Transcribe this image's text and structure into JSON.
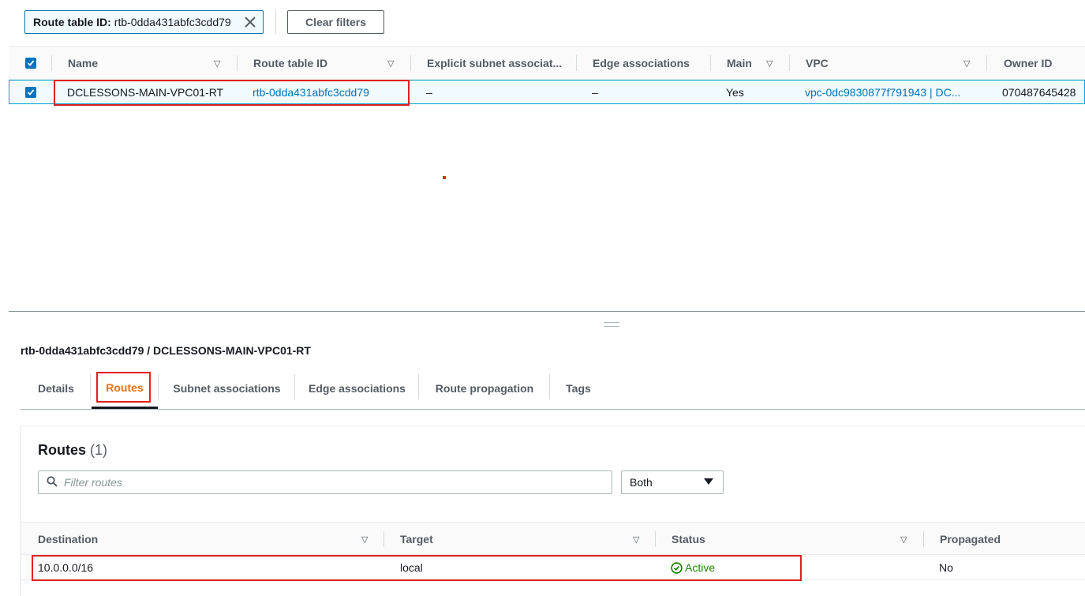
{
  "filter_bar": {
    "chip_key": "Route table ID:",
    "chip_value": "rtb-0dda431abfc3cdd79",
    "clear_label": "Clear filters"
  },
  "route_tables": {
    "columns": [
      "Name",
      "Route table ID",
      "Explicit subnet associat...",
      "Edge associations",
      "Main",
      "VPC",
      "Owner ID"
    ],
    "rows": [
      {
        "name": "DCLESSONS-MAIN-VPC01-RT",
        "route_table_id": "rtb-0dda431abfc3cdd79",
        "explicit_subnet": "–",
        "edge_assoc": "–",
        "main": "Yes",
        "vpc": "vpc-0dc9830877f791943 | DC...",
        "owner_id": "070487645428"
      }
    ]
  },
  "details": {
    "title": "rtb-0dda431abfc3cdd79 / DCLESSONS-MAIN-VPC01-RT",
    "tabs": [
      "Details",
      "Routes",
      "Subnet associations",
      "Edge associations",
      "Route propagation",
      "Tags"
    ],
    "active_tab": "Routes"
  },
  "routes": {
    "title": "Routes",
    "count": "(1)",
    "filter_placeholder": "Filter routes",
    "select_value": "Both",
    "columns": [
      "Destination",
      "Target",
      "Status",
      "Propagated"
    ],
    "rows": [
      {
        "destination": "10.0.0.0/16",
        "target": "local",
        "status": "Active",
        "propagated": "No"
      }
    ]
  },
  "colors": {
    "accent_link": "#0073bb",
    "active_tab": "#ec7211",
    "status_active": "#1d8102",
    "highlight": "#e02020"
  }
}
